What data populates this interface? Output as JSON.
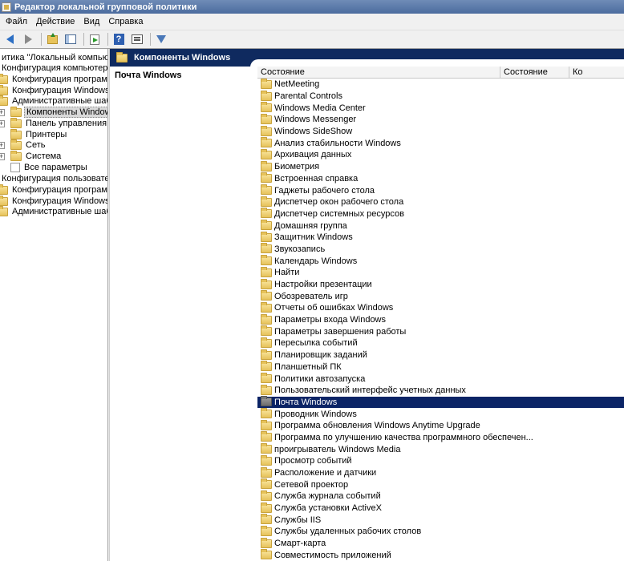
{
  "window": {
    "title": "Редактор локальной групповой политики"
  },
  "menu": [
    "Файл",
    "Действие",
    "Вид",
    "Справка"
  ],
  "toolbar": {
    "icons": [
      "arrow-left-icon",
      "arrow-right-icon",
      "folder-up-icon",
      "console-tree-icon",
      "export-list-icon",
      "help-icon",
      "properties-icon",
      "filter-icon"
    ]
  },
  "tree": {
    "items": [
      {
        "label": "итика \"Локальный компьютер",
        "indent": 0,
        "icon": "none",
        "expander": ""
      },
      {
        "label": "Конфигурация компьютера",
        "indent": 0,
        "icon": "none",
        "expander": ""
      },
      {
        "label": "Конфигурация программ",
        "indent": 0,
        "icon": "folder",
        "expander": ""
      },
      {
        "label": "Конфигурация Windows",
        "indent": 0,
        "icon": "folder",
        "expander": ""
      },
      {
        "label": "Административные шаблоны",
        "indent": 0,
        "icon": "folder",
        "expander": ""
      },
      {
        "label": "Компоненты Windows",
        "indent": 1,
        "icon": "folder",
        "expander": "+",
        "selected": true
      },
      {
        "label": "Панель управления",
        "indent": 1,
        "icon": "folder",
        "expander": "+"
      },
      {
        "label": "Принтеры",
        "indent": 1,
        "icon": "folder",
        "expander": ""
      },
      {
        "label": "Сеть",
        "indent": 1,
        "icon": "folder",
        "expander": "+"
      },
      {
        "label": "Система",
        "indent": 1,
        "icon": "folder",
        "expander": "+"
      },
      {
        "label": "Все параметры",
        "indent": 1,
        "icon": "leaf",
        "expander": ""
      },
      {
        "label": "Конфигурация пользователя",
        "indent": 0,
        "icon": "none",
        "expander": ""
      },
      {
        "label": "Конфигурация программ",
        "indent": 0,
        "icon": "folder",
        "expander": ""
      },
      {
        "label": "Конфигурация Windows",
        "indent": 0,
        "icon": "folder",
        "expander": ""
      },
      {
        "label": "Административные шаблоны",
        "indent": 0,
        "icon": "folder",
        "expander": ""
      }
    ]
  },
  "right_header": {
    "title": "Компоненты Windows"
  },
  "description": {
    "title": "Почта Windows"
  },
  "columns": [
    "Состояние",
    "Состояние",
    "Ко"
  ],
  "list": [
    "NetMeeting",
    "Parental Controls",
    "Windows Media Center",
    "Windows Messenger",
    "Windows SideShow",
    "Анализ стабильности Windows",
    "Архивация данных",
    "Биометрия",
    "Встроенная справка",
    "Гаджеты рабочего стола",
    "Диспетчер окон рабочего стола",
    "Диспетчер системных ресурсов",
    "Домашняя группа",
    "Защитник Windows",
    "Звукозапись",
    "Календарь Windows",
    "Найти",
    "Настройки презентации",
    "Обозреватель игр",
    "Отчеты об ошибках Windows",
    "Параметры входа Windows",
    "Параметры завершения работы",
    "Пересылка событий",
    "Планировщик заданий",
    "Планшетный ПК",
    "Политики автозапуска",
    "Пользовательский интерфейс учетных данных",
    "Почта Windows",
    "Проводник Windows",
    "Программа обновления Windows Anytime Upgrade",
    "Программа по улучшению качества программного обеспечен...",
    "проигрыватель Windows Media",
    "Просмотр событий",
    "Расположение и датчики",
    "Сетевой проектор",
    "Служба журнала событий",
    "Служба установки ActiveX",
    "Службы IIS",
    "Службы удаленных рабочих столов",
    "Смарт-карта",
    "Совместимость приложений"
  ],
  "selected_index": 27
}
